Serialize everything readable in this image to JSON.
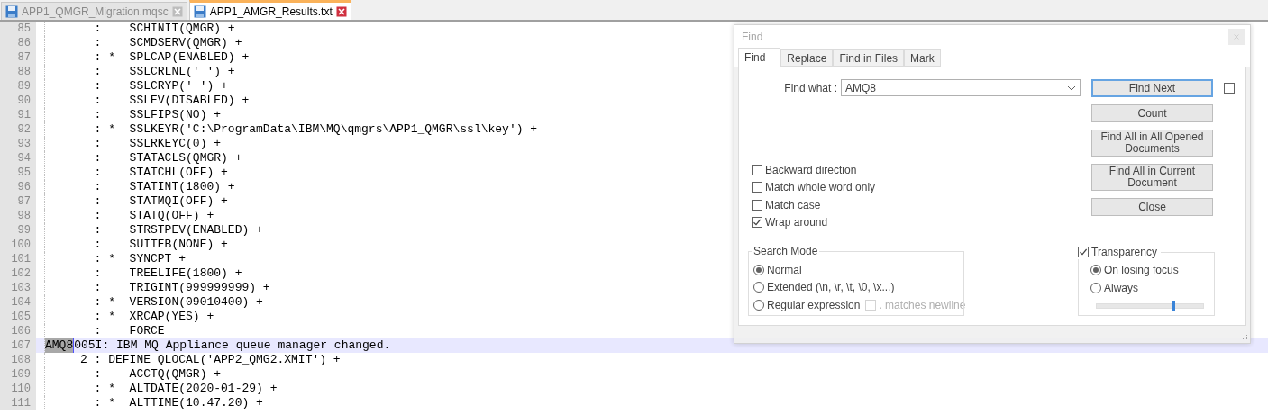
{
  "file_tabs": [
    {
      "label": "APP1_QMGR_Migration.mqsc",
      "selected": false
    },
    {
      "label": "APP1_AMGR_Results.txt",
      "selected": true
    }
  ],
  "editor": {
    "lines": [
      {
        "number": "85",
        "text": "       :    SCHINIT(QMGR) +",
        "current": false
      },
      {
        "number": "86",
        "text": "       :    SCMDSERV(QMGR) +",
        "current": false
      },
      {
        "number": "87",
        "text": "       : *  SPLCAP(ENABLED) +",
        "current": false
      },
      {
        "number": "88",
        "text": "       :    SSLCRLNL(' ') +",
        "current": false
      },
      {
        "number": "89",
        "text": "       :    SSLCRYP(' ') +",
        "current": false
      },
      {
        "number": "90",
        "text": "       :    SSLEV(DISABLED) +",
        "current": false
      },
      {
        "number": "91",
        "text": "       :    SSLFIPS(NO) +",
        "current": false
      },
      {
        "number": "92",
        "text": "       : *  SSLKEYR('C:\\ProgramData\\IBM\\MQ\\qmgrs\\APP1_QMGR\\ssl\\key') +",
        "current": false
      },
      {
        "number": "93",
        "text": "       :    SSLRKEYC(0) +",
        "current": false
      },
      {
        "number": "94",
        "text": "       :    STATACLS(QMGR) +",
        "current": false
      },
      {
        "number": "95",
        "text": "       :    STATCHL(OFF) +",
        "current": false
      },
      {
        "number": "96",
        "text": "       :    STATINT(1800) +",
        "current": false
      },
      {
        "number": "97",
        "text": "       :    STATMQI(OFF) +",
        "current": false
      },
      {
        "number": "98",
        "text": "       :    STATQ(OFF) +",
        "current": false
      },
      {
        "number": "99",
        "text": "       :    STRSTPEV(ENABLED) +",
        "current": false
      },
      {
        "number": "100",
        "text": "       :    SUITEB(NONE) +",
        "current": false
      },
      {
        "number": "101",
        "text": "       : *  SYNCPT +",
        "current": false
      },
      {
        "number": "102",
        "text": "       :    TREELIFE(1800) +",
        "current": false
      },
      {
        "number": "103",
        "text": "       :    TRIGINT(999999999) +",
        "current": false
      },
      {
        "number": "104",
        "text": "       : *  VERSION(09010400) +",
        "current": false
      },
      {
        "number": "105",
        "text": "       : *  XRCAP(YES) +",
        "current": false
      },
      {
        "number": "106",
        "text": "       :    FORCE",
        "current": false
      },
      {
        "number": "107",
        "match": "AMQ8",
        "text": "005I: IBM MQ Appliance queue manager changed.",
        "current": true
      },
      {
        "number": "108",
        "text": "     2 : DEFINE QLOCAL('APP2_QMG2.XMIT') +",
        "current": false
      },
      {
        "number": "109",
        "text": "       :    ACCTQ(QMGR) +",
        "current": false
      },
      {
        "number": "110",
        "text": "       : *  ALTDATE(2020-01-29) +",
        "current": false
      },
      {
        "number": "111",
        "text": "       : *  ALTTIME(10.47.20) +",
        "current": false
      }
    ]
  },
  "find_dialog": {
    "title": "Find",
    "tabs": [
      {
        "label": "Find",
        "selected": true
      },
      {
        "label": "Replace",
        "selected": false
      },
      {
        "label": "Find in Files",
        "selected": false
      },
      {
        "label": "Mark",
        "selected": false
      }
    ],
    "find_what": {
      "label": "Find what :",
      "value": "AMQ8"
    },
    "buttons": [
      {
        "label": "Find Next",
        "focused": true
      },
      {
        "label": "Count",
        "focused": false
      },
      {
        "label": "Find All in All Opened Documents",
        "focused": false
      },
      {
        "label": "Find All in Current Document",
        "focused": false
      },
      {
        "label": "Close",
        "focused": false
      }
    ],
    "side_checkbox": {
      "checked": false
    },
    "options": [
      {
        "label": "Backward direction",
        "checked": false
      },
      {
        "label": "Match whole word only",
        "checked": false
      },
      {
        "label": "Match case",
        "checked": false
      },
      {
        "label": "Wrap around",
        "checked": true
      }
    ],
    "search_mode": {
      "title": "Search Mode",
      "options": [
        {
          "label": "Normal",
          "selected": true
        },
        {
          "label": "Extended (\\n, \\r, \\t, \\0, \\x...)",
          "selected": false
        },
        {
          "label": "Regular expression",
          "selected": false
        }
      ],
      "newline_option": {
        "label": ". matches newline",
        "checked": false,
        "disabled": true
      }
    },
    "transparency": {
      "label": "Transparency",
      "checked": true,
      "options": [
        {
          "label": "On losing focus",
          "selected": true
        },
        {
          "label": "Always",
          "selected": false
        }
      ],
      "slider": {
        "level": 0.72
      }
    }
  }
}
